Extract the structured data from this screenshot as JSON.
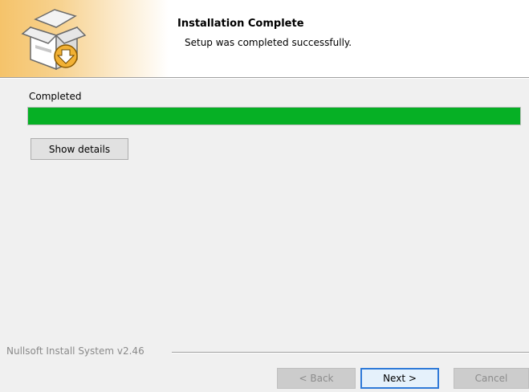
{
  "header": {
    "title": "Installation Complete",
    "subtitle": "Setup was completed successfully.",
    "icon": "installer-box-download-icon"
  },
  "progress": {
    "status_label": "Completed",
    "value_percent": 100,
    "color": "#06b025"
  },
  "details_button": {
    "label": "Show details"
  },
  "footer": {
    "branding": "Nullsoft Install System v2.46",
    "back_label": "< Back",
    "next_label": "Next >",
    "cancel_label": "Cancel"
  }
}
